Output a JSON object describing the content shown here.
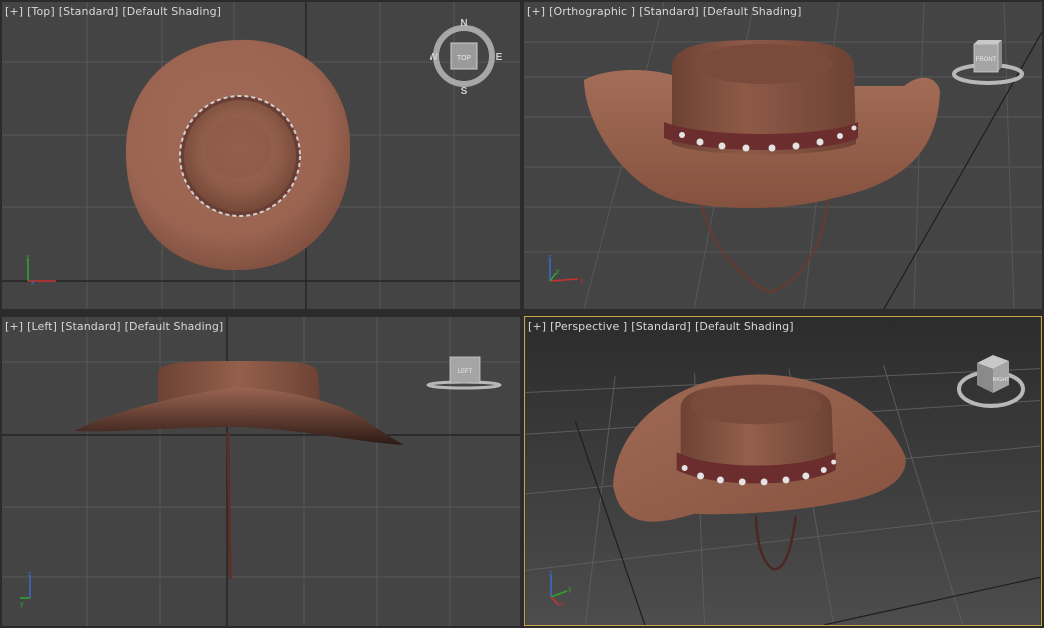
{
  "viewports": {
    "top": {
      "menu": "[+]",
      "view": "[Top]",
      "style": "[Standard]",
      "shading": "[Default Shading]",
      "compass": {
        "n": "N",
        "s": "S",
        "e": "E",
        "w": "W",
        "cube": "TOP"
      }
    },
    "ortho": {
      "menu": "[+]",
      "view": "[Orthographic ]",
      "style": "[Standard]",
      "shading": "[Default Shading]",
      "cube": "FRONT"
    },
    "left": {
      "menu": "[+]",
      "view": "[Left]",
      "style": "[Standard]",
      "shading": "[Default Shading]",
      "cube": "LEFT"
    },
    "persp": {
      "menu": "[+]",
      "view": "[Perspective ]",
      "style": "[Standard]",
      "shading": "[Default Shading]",
      "cube": "RIGHT"
    }
  },
  "axes": {
    "x": "x",
    "y": "y",
    "z": "z"
  },
  "colors": {
    "viewport_bg": "#444444",
    "active_border": "#c8a64a",
    "hat": "#9b6450",
    "band": "#6b2d2d",
    "grid": "#5a5a5a"
  }
}
